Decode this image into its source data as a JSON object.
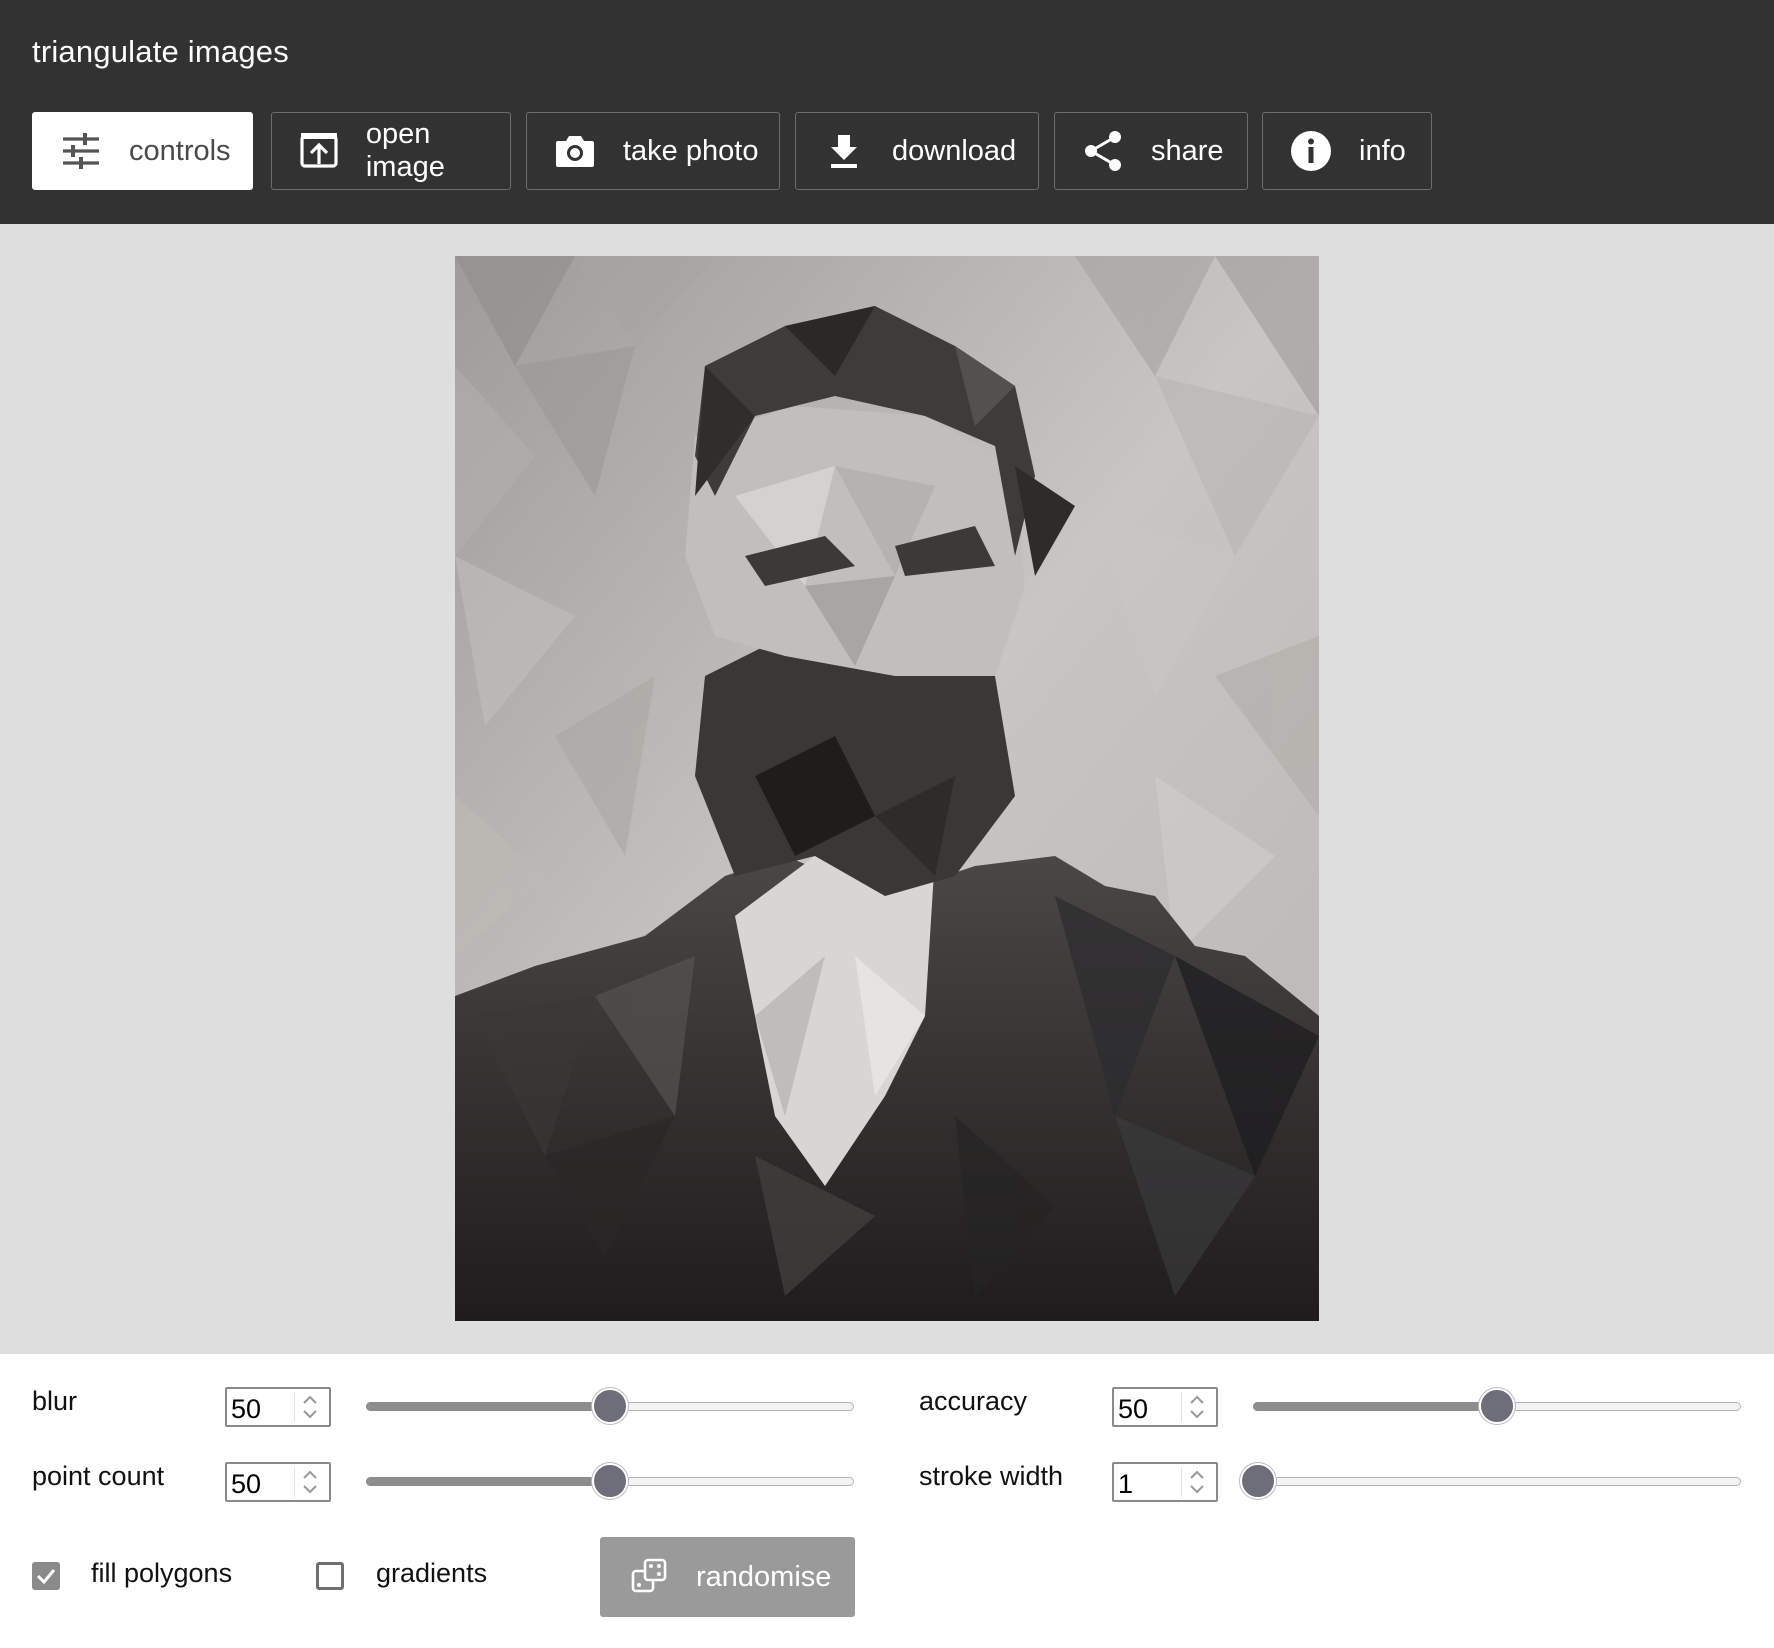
{
  "app": {
    "title": "triangulate images"
  },
  "toolbar": {
    "buttons": [
      {
        "label": "controls",
        "icon": "sliders-icon",
        "active": true
      },
      {
        "label": "open image",
        "icon": "open-image-icon",
        "active": false
      },
      {
        "label": "take photo",
        "icon": "camera-icon",
        "active": false
      },
      {
        "label": "download",
        "icon": "download-icon",
        "active": false
      },
      {
        "label": "share",
        "icon": "share-icon",
        "active": false
      },
      {
        "label": "info",
        "icon": "info-icon",
        "active": false
      }
    ]
  },
  "controls": {
    "blur": {
      "label": "blur",
      "value": "50",
      "min": 0,
      "max": 100
    },
    "accuracy": {
      "label": "accuracy",
      "value": "50",
      "min": 0,
      "max": 100
    },
    "point_count": {
      "label": "point count",
      "value": "50",
      "min": 0,
      "max": 100
    },
    "stroke_width": {
      "label": "stroke width",
      "value": "1",
      "min": 0,
      "max": 100
    },
    "fill_polygons": {
      "label": "fill polygons",
      "checked": true
    },
    "gradients": {
      "label": "gradients",
      "checked": false
    },
    "randomise": {
      "label": "randomise",
      "icon": "dice-icon"
    }
  },
  "colors": {
    "header_bg": "#323232",
    "stage_bg": "#dedede",
    "panel_bg": "#ffffff",
    "thumb": "#6e6e7b",
    "button_disabled": "#9a9a9a"
  }
}
